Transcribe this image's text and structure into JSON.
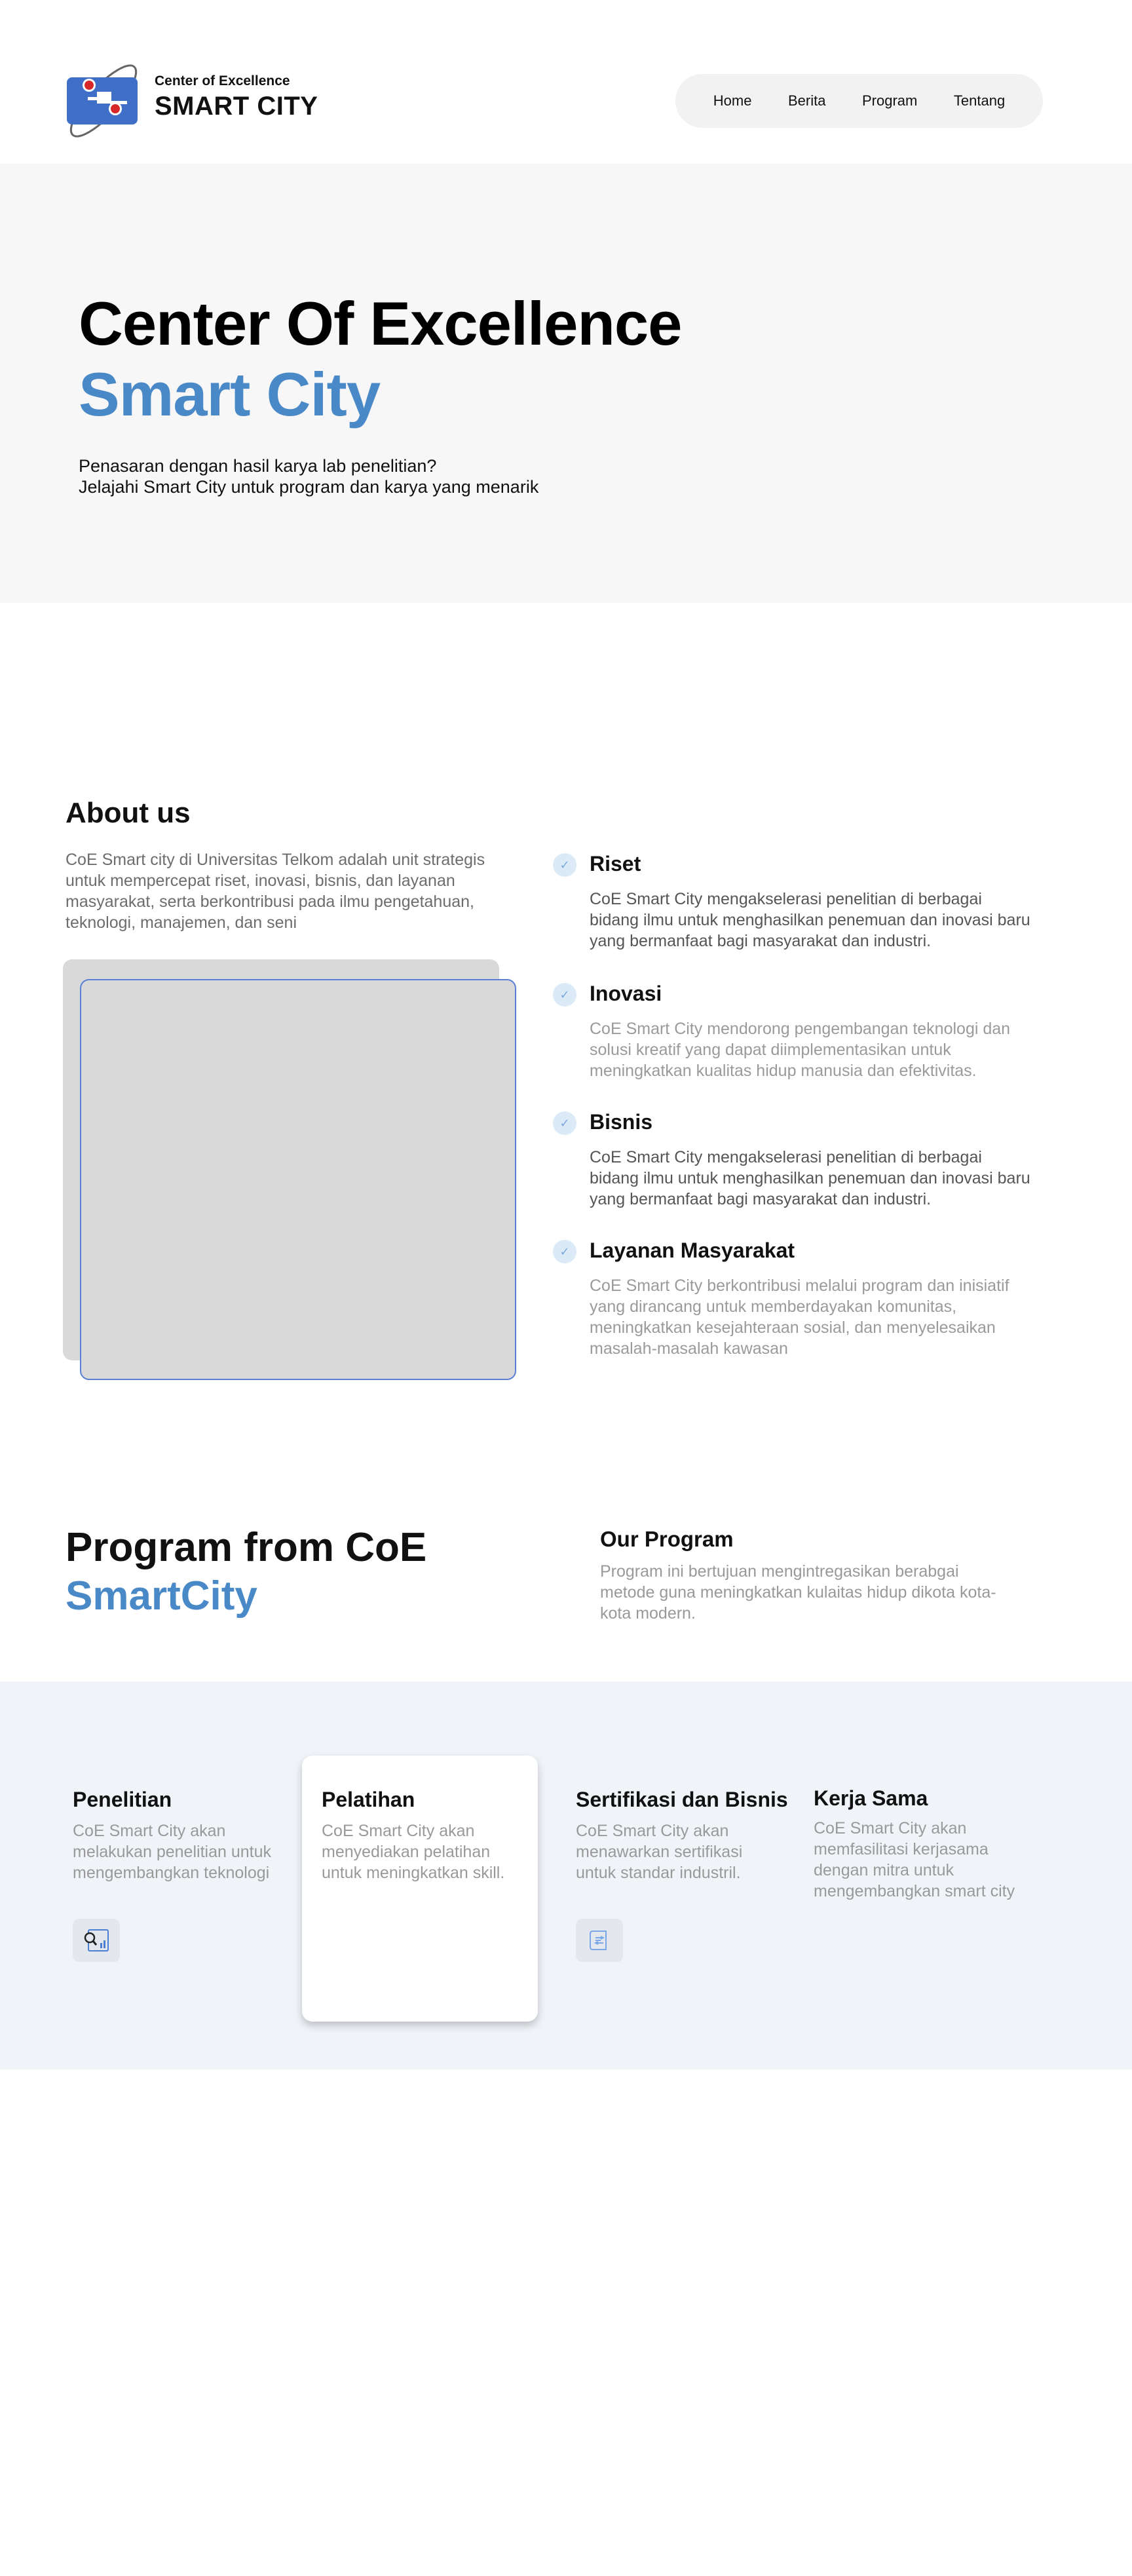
{
  "header": {
    "brand_small": "Center of Excellence",
    "brand_big": "SMART CITY",
    "nav": [
      "Home",
      "Berita",
      "Program",
      "Tentang"
    ]
  },
  "hero": {
    "title": "Center Of Excellence",
    "subtitle": "Smart City",
    "line1": "Penasaran dengan hasil karya lab penelitian?",
    "line2": "Jelajahi Smart City untuk program dan karya yang menarik"
  },
  "about": {
    "title": "About us",
    "description": "CoE Smart city di Universitas Telkom adalah unit strategis untuk mempercepat riset, inovasi, bisnis, dan layanan masyarakat, serta berkontribusi pada ilmu pengetahuan, teknologi, manajemen, dan seni",
    "features": [
      {
        "title": "Riset",
        "text": "CoE Smart City mengakselerasi penelitian di berbagai bidang ilmu untuk menghasilkan penemuan dan inovasi baru yang bermanfaat bagi masyarakat dan industri."
      },
      {
        "title": "Inovasi",
        "text": "CoE Smart City mendorong pengembangan teknologi dan solusi kreatif yang dapat diimplementasikan untuk meningkatkan kualitas hidup manusia dan efektivitas."
      },
      {
        "title": "Bisnis",
        "text": "CoE Smart City mengakselerasi penelitian di berbagai bidang ilmu untuk menghasilkan penemuan dan inovasi baru yang bermanfaat bagi masyarakat dan industri."
      },
      {
        "title": "Layanan Masyarakat",
        "text": "CoE Smart City berkontribusi melalui program dan inisiatif yang dirancang untuk memberdayakan komunitas, meningkatkan kesejahteraan sosial, dan menyelesaikan masalah-masalah kawasan"
      }
    ]
  },
  "program": {
    "title": "Program from CoE",
    "subtitle": "SmartCity",
    "our_title": "Our Program",
    "our_desc": "Program ini bertujuan mengintregasikan  berabgai metode guna meningkatkan kulaitas hidup dikota kota-kota modern.",
    "cards": [
      {
        "title": "Penelitian",
        "text": "CoE Smart City akan melakukan penelitian untuk mengembangkan teknologi",
        "icon": "research-chart-icon"
      },
      {
        "title": "Pelatihan",
        "text": "CoE Smart City akan menyediakan pelatihan untuk meningkatkan skill."
      },
      {
        "title": "Sertifikasi dan Bisnis",
        "text": "CoE Smart City akan menawarkan sertifikasi untuk standar industril.",
        "icon": "certificate-document-icon"
      },
      {
        "title": "Kerja Sama",
        "text": "CoE Smart City akan memfasilitasi kerjasama dengan mitra untuk mengembangkan smart city"
      }
    ]
  },
  "colors": {
    "accent_blue": "#4a89c7",
    "hero_bg": "#f7f7f7",
    "band_bg": "#f0f4f8"
  }
}
